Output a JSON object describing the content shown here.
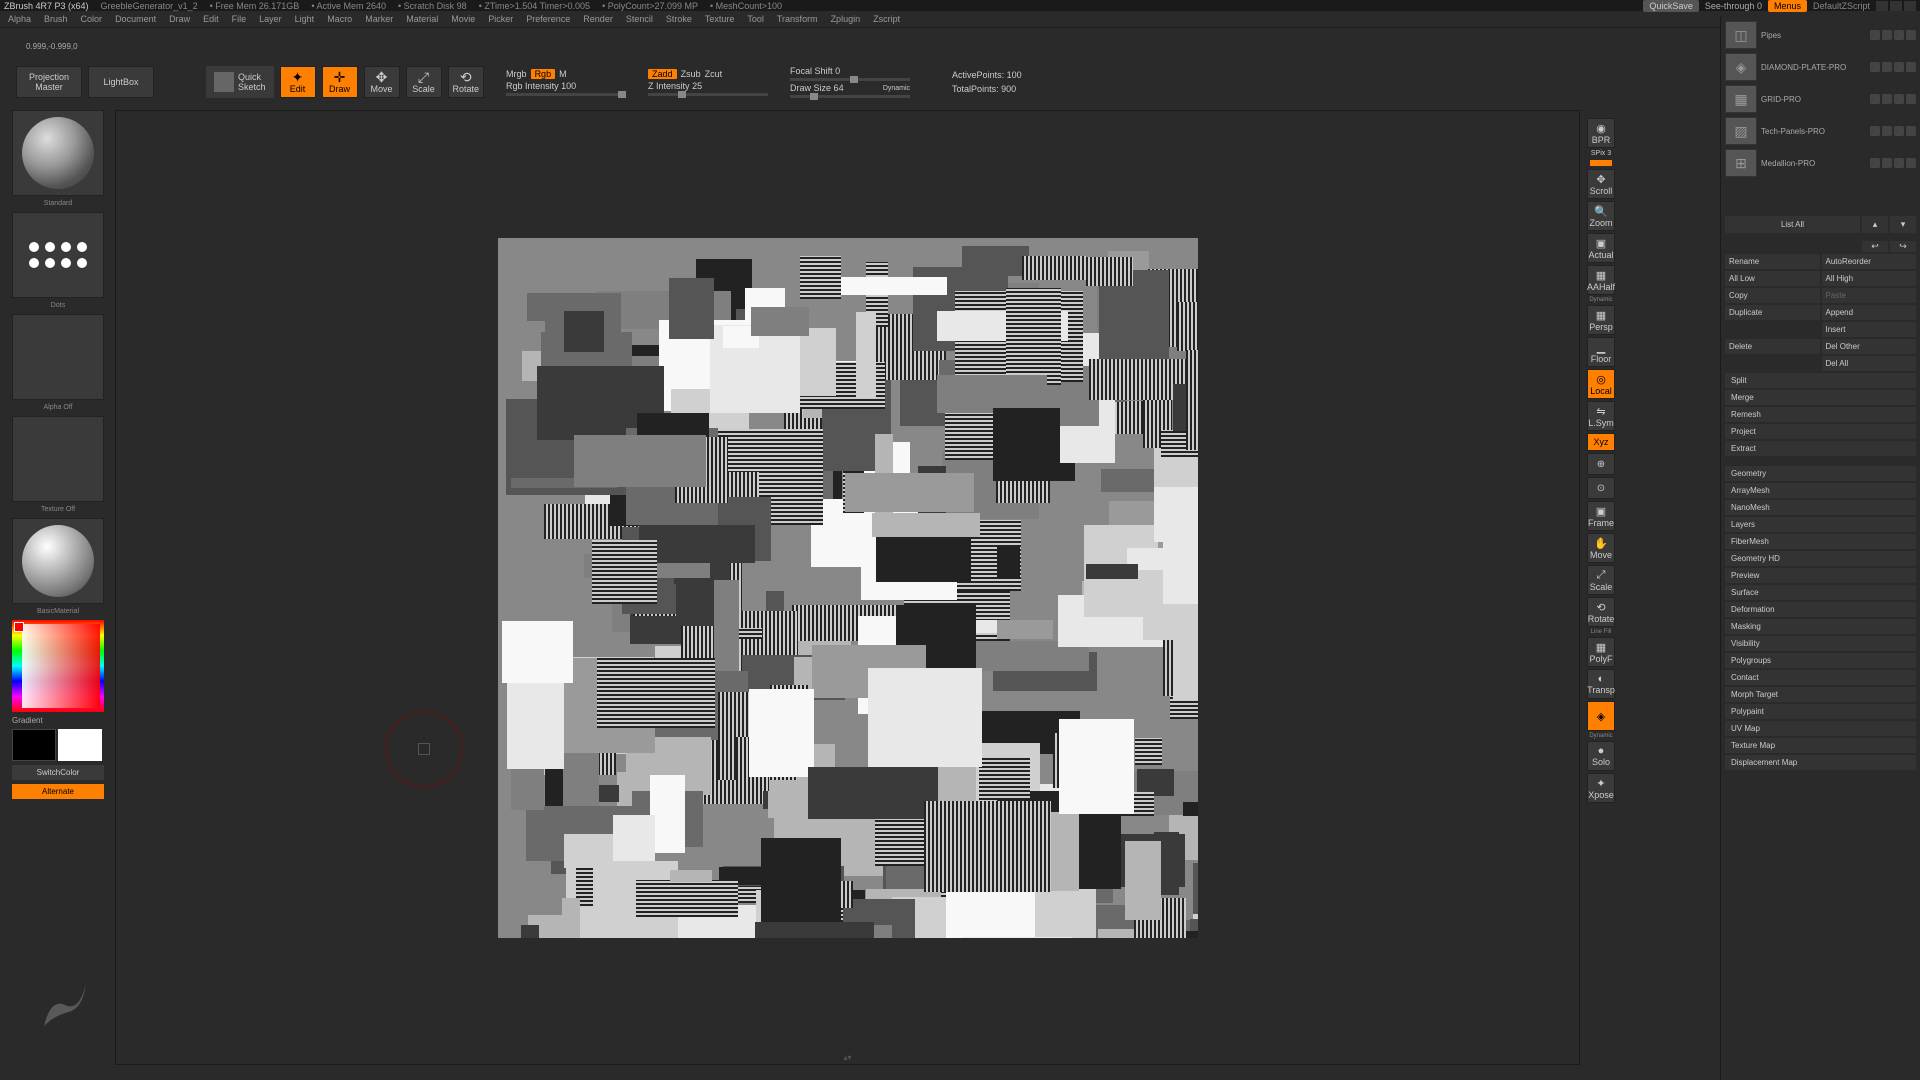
{
  "titlebar": {
    "app": "ZBrush 4R7 P3 (x64)",
    "file": "GreebleGenerator_v1_2",
    "freemem": "• Free Mem 26.171GB",
    "activemem": "• Active Mem 2640",
    "scratch": "• Scratch Disk 98",
    "ztime": "• ZTime>1.504 Timer>0.005",
    "polycount": "• PolyCount>27.099 MP",
    "meshcount": "• MeshCount>100",
    "quicksave": "QuickSave",
    "seethrough": "See-through   0",
    "menus": "Menus",
    "script": "DefaultZScript"
  },
  "menubar": [
    "Alpha",
    "Brush",
    "Color",
    "Document",
    "Draw",
    "Edit",
    "File",
    "Layer",
    "Light",
    "Macro",
    "Marker",
    "Material",
    "Movie",
    "Picker",
    "Preference",
    "Render",
    "Stencil",
    "Stroke",
    "Texture",
    "Tool",
    "Transform",
    "Zplugin",
    "Zscript"
  ],
  "coord": "0.999,-0.999,0",
  "toolbar": {
    "projection": "Projection\nMaster",
    "lightbox": "LightBox",
    "quick": "Quick\nSketch",
    "edit": "Edit",
    "draw": "Draw",
    "move": "Move",
    "scale": "Scale",
    "rotate": "Rotate",
    "mrgb": "Mrgb",
    "rgb": "Rgb",
    "m": "M",
    "rgbint": "Rgb Intensity 100",
    "zadd": "Zadd",
    "zsub": "Zsub",
    "zcut": "Zcut",
    "zint": "Z Intensity 25",
    "focal": "Focal Shift 0",
    "drawsize": "Draw Size 64",
    "dynamic": "Dynamic",
    "active": "ActivePoints: 100",
    "total": "TotalPoints: 900"
  },
  "left": {
    "brush": "Standard",
    "stroke": "Dots",
    "alpha": "Alpha Off",
    "texture": "Texture Off",
    "material": "BasicMaterial",
    "gradient": "Gradient",
    "switchcolor": "SwitchColor",
    "alternate": "Alternate"
  },
  "rshelf": {
    "bpr": "BPR",
    "spix": "SPix 3",
    "scroll": "Scroll",
    "zoom": "Zoom",
    "actual": "Actual",
    "aahalf": "AAHalf",
    "persp": "Persp",
    "floor": "Floor",
    "local": "Local",
    "lsym": "L.Sym",
    "xyz": "Xyz",
    "frame": "Frame",
    "movecam": "Move",
    "scalecam": "Scale",
    "rotatecam": "Rotate",
    "linefill": "Line Fill",
    "polyf": "PolyF",
    "transp": "Transp",
    "ghost": "Ghost",
    "solo": "Solo",
    "xpose": "Xpose"
  },
  "tools": [
    {
      "name": "Pipes"
    },
    {
      "name": "DIAMOND-PLATE-PRO"
    },
    {
      "name": "GRID-PRO"
    },
    {
      "name": "Tech-Panels-PRO"
    },
    {
      "name": "Medallion-PRO"
    }
  ],
  "listall": "List All",
  "subtool": {
    "rename": "Rename",
    "autoreorder": "AutoReorder",
    "alllow": "All Low",
    "allhigh": "All High",
    "copy": "Copy",
    "paste": "Paste",
    "duplicate": "Duplicate",
    "append": "Append",
    "insert": "Insert",
    "delete": "Delete",
    "delother": "Del Other",
    "delall": "Del All",
    "split": "Split",
    "merge": "Merge",
    "remesh": "Remesh",
    "project": "Project",
    "extract": "Extract"
  },
  "sections": [
    "Geometry",
    "ArrayMesh",
    "NanoMesh",
    "Layers",
    "FiberMesh",
    "Geometry HD",
    "Preview",
    "Surface",
    "Deformation",
    "Masking",
    "Visibility",
    "Polygroups",
    "Contact",
    "Morph Target",
    "Polypaint",
    "UV Map",
    "Texture Map",
    "Displacement Map"
  ]
}
